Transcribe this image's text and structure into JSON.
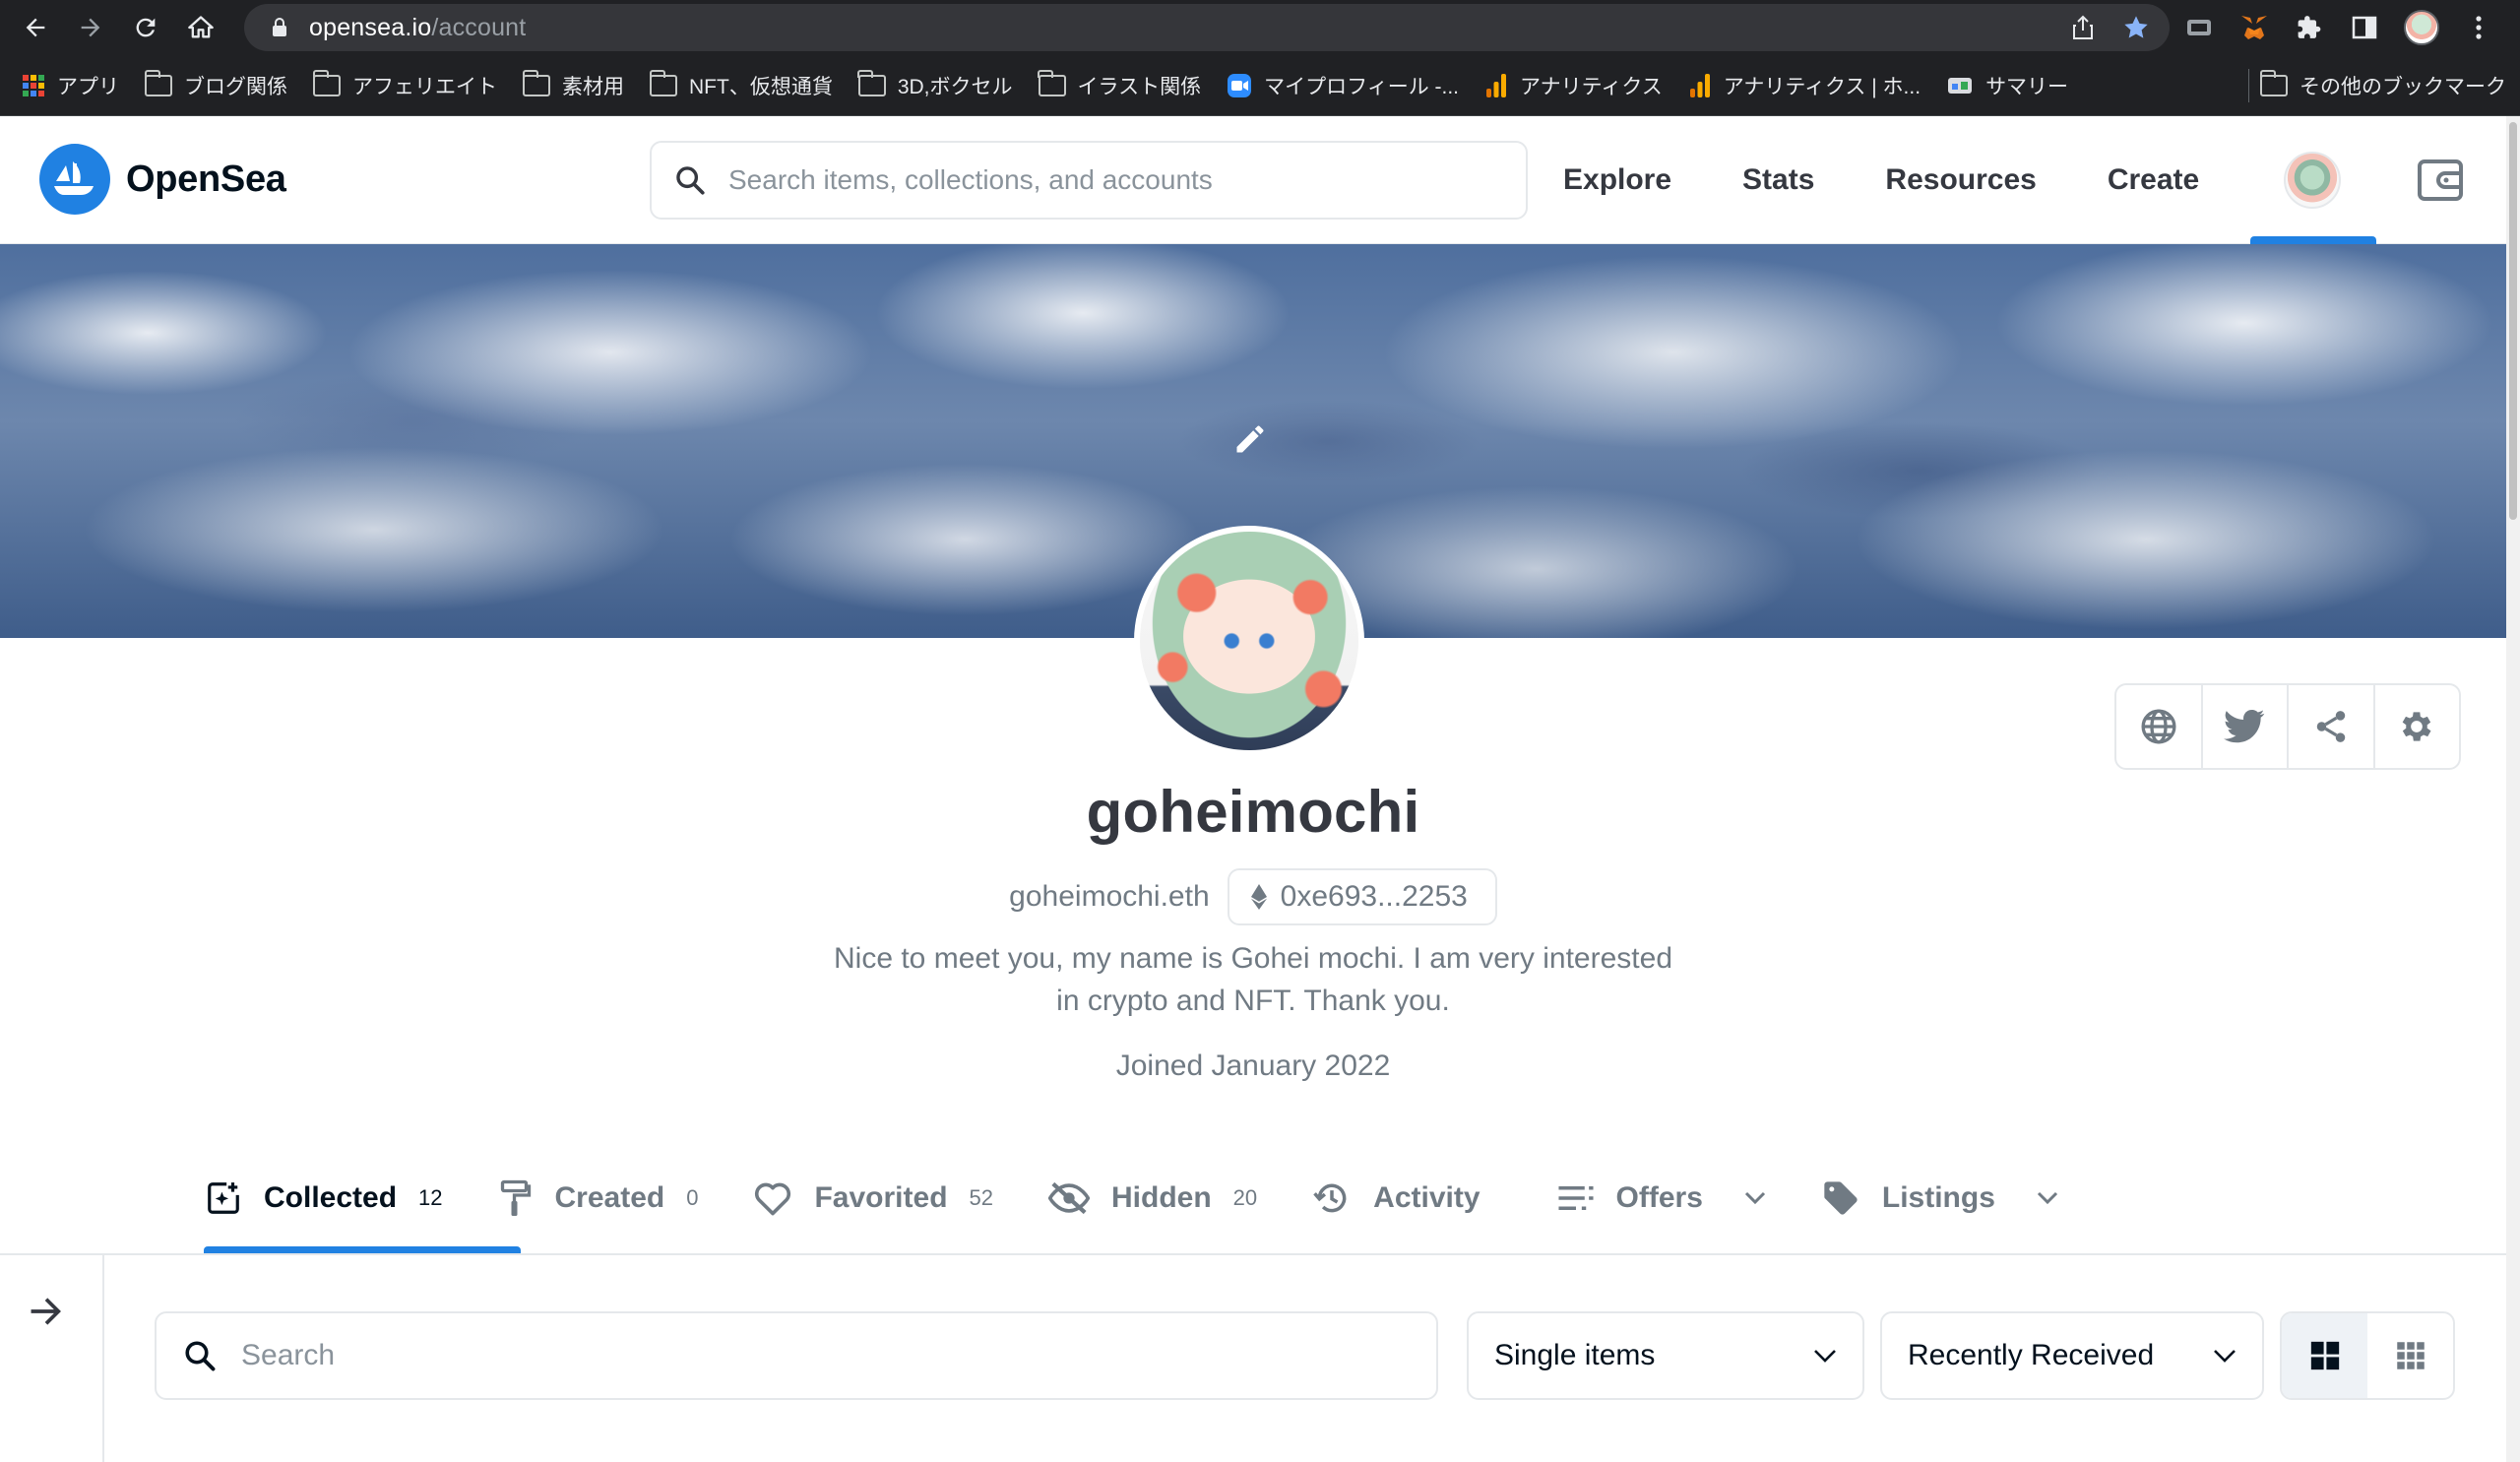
{
  "browser": {
    "url_host": "opensea.io",
    "url_path": "/account",
    "bookmarks": [
      {
        "label": "アプリ",
        "icon": "apps-grid-icon"
      },
      {
        "label": "ブログ関係",
        "icon": "folder-icon"
      },
      {
        "label": "アフェリエイト",
        "icon": "folder-icon"
      },
      {
        "label": "素材用",
        "icon": "folder-icon"
      },
      {
        "label": "NFT、仮想通貨",
        "icon": "folder-icon"
      },
      {
        "label": "3D,ボクセル",
        "icon": "folder-icon"
      },
      {
        "label": "イラスト関係",
        "icon": "folder-icon"
      },
      {
        "label": "マイプロフィール -...",
        "icon": "zoom-icon"
      },
      {
        "label": "アナリティクス",
        "icon": "analytics-icon"
      },
      {
        "label": "アナリティクス | ホ...",
        "icon": "analytics-icon"
      },
      {
        "label": "サマリー",
        "icon": "summary-icon"
      }
    ],
    "other_bookmarks": "その他のブックマーク"
  },
  "header": {
    "brand": "OpenSea",
    "search_placeholder": "Search items, collections, and accounts",
    "nav": [
      "Explore",
      "Stats",
      "Resources",
      "Create"
    ]
  },
  "profile": {
    "username": "goheimochi",
    "ens": "goheimochi.eth",
    "address": "0xe693...2253",
    "bio": "Nice to meet you, my name is Gohei mochi. I am very interested in crypto and NFT. Thank you.",
    "joined": "Joined January 2022"
  },
  "tabs": [
    {
      "label": "Collected",
      "count": "12",
      "icon": "collected-icon",
      "active": true
    },
    {
      "label": "Created",
      "count": "0",
      "icon": "paint-roller-icon"
    },
    {
      "label": "Favorited",
      "count": "52",
      "icon": "heart-icon"
    },
    {
      "label": "Hidden",
      "count": "20",
      "icon": "eye-off-icon"
    },
    {
      "label": "Activity",
      "count": "",
      "icon": "history-icon"
    },
    {
      "label": "Offers",
      "count": "",
      "icon": "list-icon",
      "dropdown": true
    },
    {
      "label": "Listings",
      "count": "",
      "icon": "tag-icon",
      "dropdown": true
    }
  ],
  "filters": {
    "search_placeholder": "Search",
    "type_select": "Single items",
    "sort_select": "Recently Received"
  },
  "colors": {
    "accent": "#2081e2",
    "text_primary": "#04111d",
    "text_secondary": "#707a83",
    "border": "#e5e8eb"
  }
}
